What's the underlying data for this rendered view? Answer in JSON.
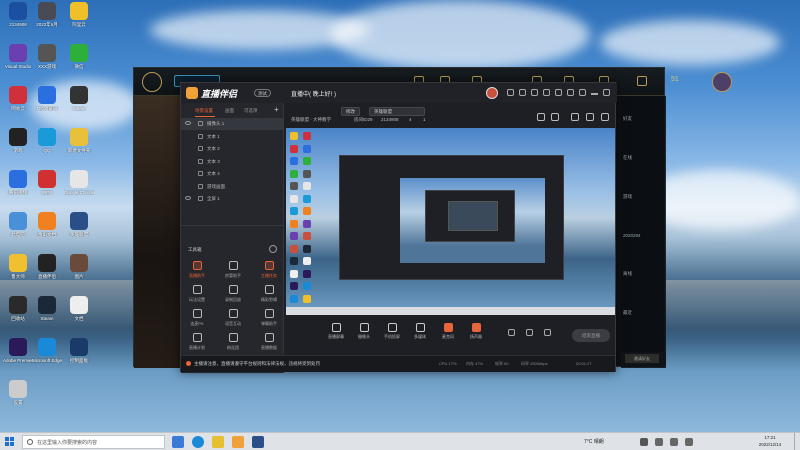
{
  "desktop": {
    "icons": [
      {
        "label": "2134908",
        "color": "#1b4fa0"
      },
      {
        "label": "2022年6月",
        "color": "#4a4a55"
      },
      {
        "label": "阿里云",
        "color": "#f0c02a"
      },
      {
        "label": "Visual Studio",
        "color": "#6a3fb0"
      },
      {
        "label": "XXX游戏",
        "color": "#555"
      },
      {
        "label": "微信",
        "color": "#2db03a"
      },
      {
        "label": "网易云",
        "color": "#d0303a"
      },
      {
        "label": "QQ浏览器",
        "color": "#2a6ee0"
      },
      {
        "label": "Steam",
        "color": "#333"
      },
      {
        "label": "游戏",
        "color": "#222"
      },
      {
        "label": "QQ",
        "color": "#1a9ad8"
      },
      {
        "label": "新建文件夹",
        "color": "#e8c03a"
      },
      {
        "label": "腾讯视频",
        "color": "#2a6ee0"
      },
      {
        "label": "WPS",
        "color": "#d03030"
      },
      {
        "label": "Google Chrome",
        "color": "#e6e6e6"
      },
      {
        "label": "此电脑",
        "color": "#4a90d9"
      },
      {
        "label": "金山文档",
        "color": "#f08020"
      },
      {
        "label": "英雄联盟",
        "color": "#2a4f88"
      },
      {
        "label": "鲁大师",
        "color": "#f0c030"
      },
      {
        "label": "直播伴侣",
        "color": "#222"
      },
      {
        "label": "图片",
        "color": "#6a4a3a"
      },
      {
        "label": "回收站",
        "color": "#2a2a2a"
      },
      {
        "label": "Steam",
        "color": "#1b2838"
      },
      {
        "label": "文档",
        "color": "#eee"
      },
      {
        "label": "Adobe Premiere",
        "color": "#2a1a5a"
      },
      {
        "label": "Microsoft Edge",
        "color": "#1a8ad8"
      },
      {
        "label": "控制面板",
        "color": "#1a3a6a"
      },
      {
        "label": "设置",
        "color": "#ccc"
      }
    ]
  },
  "game": {
    "count": "51",
    "side_items": [
      "好友",
      "在线",
      "游戏",
      "2020294",
      "离线",
      "最近"
    ],
    "bottom_btn": "邀请好友"
  },
  "app": {
    "brand": "直播伴侣",
    "badge": "测试",
    "status_title": "直播中( 晚上好! )",
    "pill1": "修改",
    "pill2": "英雄联盟",
    "sub_category": "英雄联盟 · 大神教学",
    "room_id": "房间ID29",
    "room_num": "2134908",
    "viewers": "4",
    "count2": "1",
    "tabs": [
      "场景设置",
      "画面",
      "可选项"
    ],
    "scenes": [
      {
        "label": "摄像头 1",
        "sel": true
      },
      {
        "label": "文本 1",
        "sel": false
      },
      {
        "label": "文本 2",
        "sel": false
      },
      {
        "label": "文本 3",
        "sel": false
      },
      {
        "label": "文本 4",
        "sel": false
      },
      {
        "label": "游戏画面",
        "sel": false
      },
      {
        "label": "全屏 1",
        "sel": false
      }
    ],
    "tools_title": "工具箱",
    "tools": [
      {
        "label": "直播助手",
        "hot": true
      },
      {
        "label": "房管助手",
        "hot": false
      },
      {
        "label": "主播任务",
        "hot": true
      },
      {
        "label": "玩法设置",
        "hot": false
      },
      {
        "label": "录制回放",
        "hot": false
      },
      {
        "label": "精彩剪辑",
        "hot": false
      },
      {
        "label": "连麦PK",
        "hot": false
      },
      {
        "label": "语音互动",
        "hot": false
      },
      {
        "label": "弹幕助手",
        "hot": false
      },
      {
        "label": "直播计划",
        "hot": false
      },
      {
        "label": "粉丝团",
        "hot": false
      },
      {
        "label": "直播数据",
        "hot": false
      }
    ],
    "toolbar": [
      {
        "label": "直播屏幕",
        "red": false
      },
      {
        "label": "摄像头",
        "red": false
      },
      {
        "label": "手机投屏",
        "red": false
      },
      {
        "label": "多媒体",
        "red": false
      },
      {
        "label": "麦克风",
        "red": true
      },
      {
        "label": "扬声器",
        "red": true
      }
    ],
    "live_btn": "结束直播",
    "notice": "主播请注意，直播请遵守平台规则和法律法规，违规将受到处罚",
    "stats": {
      "cpu": "CPU 17%",
      "mem": "内存 47%",
      "fps": "帧率 60",
      "bitrate": "码率 2500kbps",
      "time": "00:01:27"
    }
  },
  "taskbar": {
    "search_placeholder": "在这里输入你要搜索的内容",
    "weather": "7°C 晴朗",
    "time": "17:21",
    "date": "2022/12/14"
  }
}
